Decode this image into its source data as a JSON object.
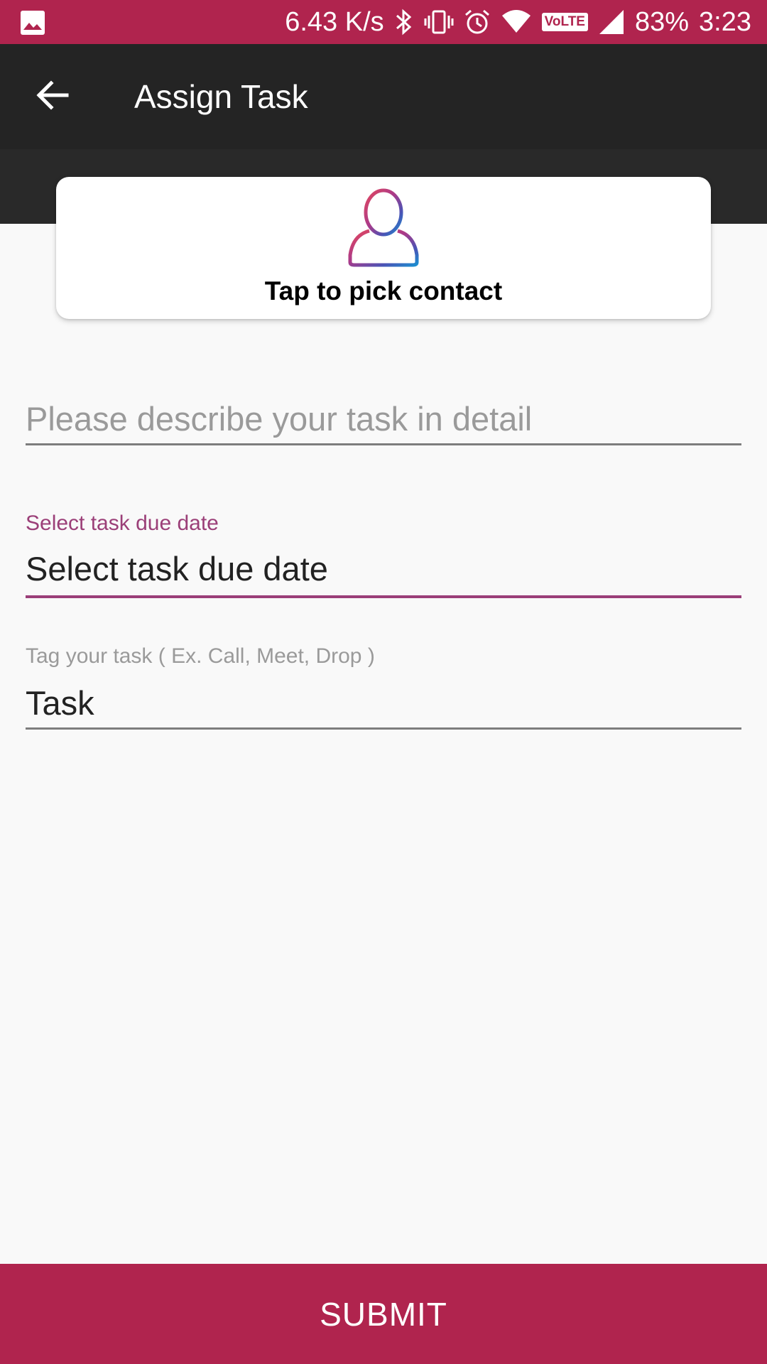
{
  "status_bar": {
    "network_speed": "6.43 K/s",
    "volte": "VoLTE",
    "battery": "83%",
    "time": "3:23",
    "icons": [
      "gallery-icon",
      "bluetooth-icon",
      "vibrate-icon",
      "alarm-icon",
      "wifi-icon",
      "volte-icon",
      "signal-icon"
    ]
  },
  "app_bar": {
    "title": "Assign Task",
    "back_icon": "arrow-left-icon"
  },
  "contact_card": {
    "label": "Tap to pick contact",
    "icon": "person-icon"
  },
  "form": {
    "description": {
      "placeholder": "Please describe your task in detail",
      "value": ""
    },
    "due_date": {
      "label": "Select task due date",
      "value": "Select task due date"
    },
    "tag": {
      "label": "Tag your task ( Ex. Call, Meet, Drop )",
      "value": "Task"
    }
  },
  "submit": {
    "label": "SUBMIT"
  },
  "colors": {
    "accent": "#b0244e",
    "focus": "#9b3f78",
    "toolbar": "#242424",
    "background": "#f9f9f9"
  }
}
